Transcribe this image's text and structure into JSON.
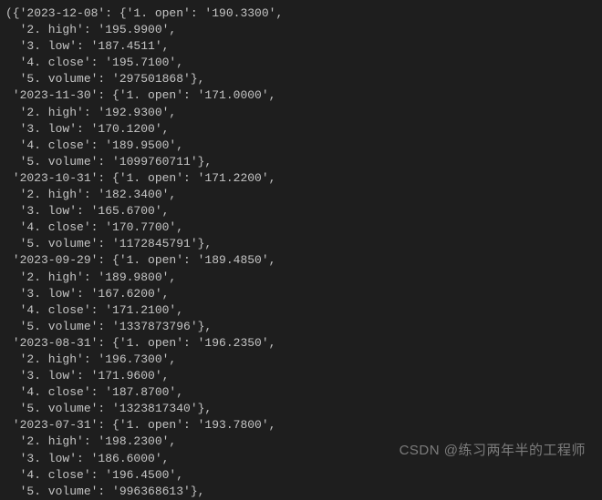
{
  "watermark": "CSDN @练习两年半的工程师",
  "code": {
    "prefix": "({",
    "indent": "  ",
    "entries": [
      {
        "date": "2023-12-08",
        "open": "190.3300",
        "high": "195.9900",
        "low": "187.4511",
        "close": "195.7100",
        "volume": "297501868"
      },
      {
        "date": "2023-11-30",
        "open": "171.0000",
        "high": "192.9300",
        "low": "170.1200",
        "close": "189.9500",
        "volume": "1099760711"
      },
      {
        "date": "2023-10-31",
        "open": "171.2200",
        "high": "182.3400",
        "low": "165.6700",
        "close": "170.7700",
        "volume": "1172845791"
      },
      {
        "date": "2023-09-29",
        "open": "189.4850",
        "high": "189.9800",
        "low": "167.6200",
        "close": "171.2100",
        "volume": "1337873796"
      },
      {
        "date": "2023-08-31",
        "open": "196.2350",
        "high": "196.7300",
        "low": "171.9600",
        "close": "187.8700",
        "volume": "1323817340"
      },
      {
        "date": "2023-07-31",
        "open": "193.7800",
        "high": "198.2300",
        "low": "186.6000",
        "close": "196.4500",
        "volume": "996368613"
      }
    ]
  }
}
